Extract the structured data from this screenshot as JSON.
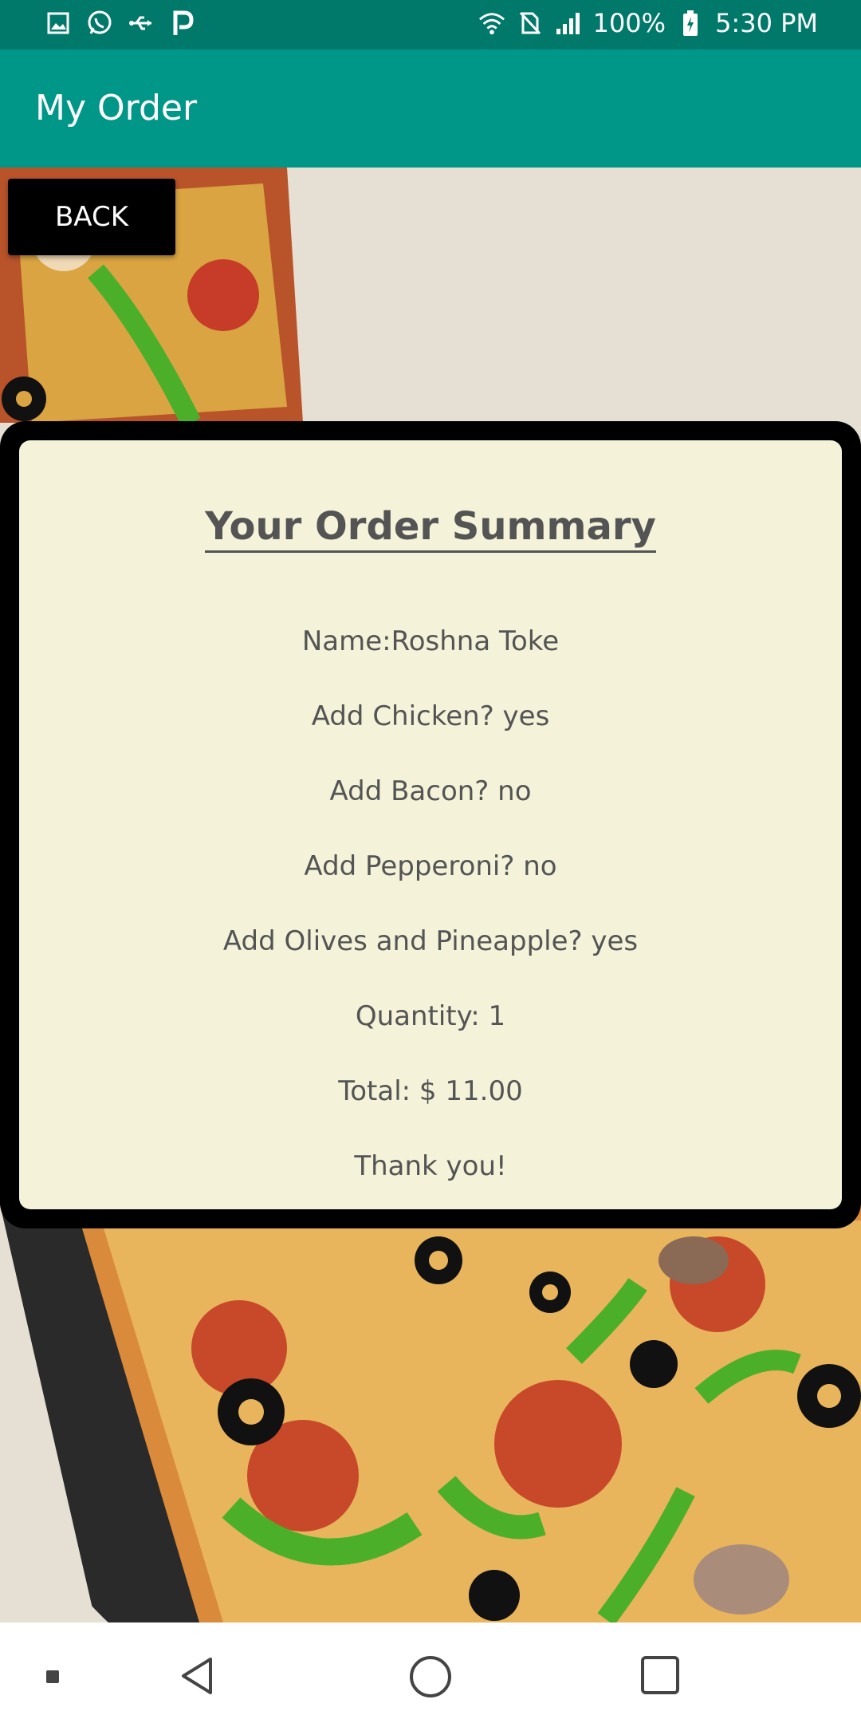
{
  "status_bar": {
    "left_icons": [
      "image-icon",
      "whatsapp-icon",
      "usb-icon",
      "p-icon"
    ],
    "battery_percent": "100%",
    "time": "5:30 PM"
  },
  "app_bar": {
    "title": "My Order"
  },
  "back_button": {
    "label": "BACK"
  },
  "summary": {
    "heading": "Your Order Summary",
    "lines": [
      "Name:Roshna Toke",
      "Add Chicken? yes",
      "Add Bacon? no",
      "Add Pepperoni? no",
      "Add Olives and Pineapple? yes",
      "Quantity: 1",
      "Total: $ 11.00",
      "Thank you!"
    ]
  },
  "colors": {
    "status_bar": "#00796b",
    "app_bar": "#009688",
    "card_bg": "#f4f3d9",
    "card_border": "#000000",
    "text": "#545454"
  }
}
